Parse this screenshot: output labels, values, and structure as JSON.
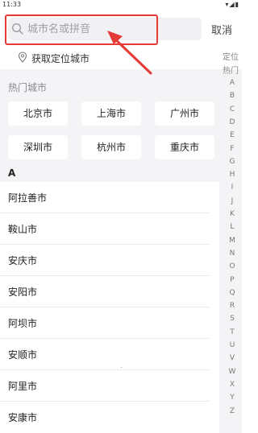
{
  "status_bar": {
    "time": "11:33",
    "icons": "▾◢▮"
  },
  "search": {
    "placeholder": "城市名或拼音",
    "cancel_label": "取消"
  },
  "locate": {
    "label": "获取定位城市",
    "right_label_1": "定位",
    "right_label_2": "热门"
  },
  "hot_cities": {
    "title": "热门城市",
    "items": [
      "北京市",
      "上海市",
      "广州市",
      "深圳市",
      "杭州市",
      "重庆市"
    ]
  },
  "city_section": {
    "letter": "A",
    "items": [
      "阿拉善市",
      "鞍山市",
      "安庆市",
      "安阳市",
      "阿坝市",
      "安顺市",
      "阿里市",
      "安康市"
    ]
  },
  "alphabet_index": [
    "A",
    "B",
    "C",
    "D",
    "E",
    "F",
    "G",
    "H",
    "I",
    "J",
    "K",
    "L",
    "M",
    "N",
    "O",
    "P",
    "Q",
    "R",
    "S",
    "T",
    "U",
    "V",
    "W",
    "X",
    "Y",
    "Z"
  ],
  "colors": {
    "highlight": "#e53935",
    "background": "#f4f4f6"
  }
}
